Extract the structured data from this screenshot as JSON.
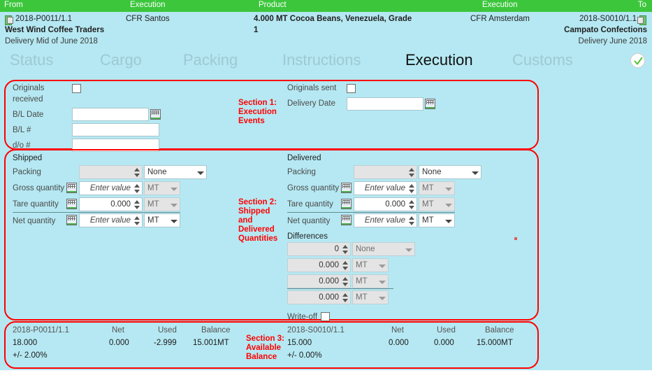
{
  "topbar": {
    "from": "From",
    "execution_left": "Execution",
    "product": "Product",
    "execution_right": "Execution",
    "to": "To"
  },
  "header": {
    "left_ref": "2018-P0011/1.1",
    "left_party": "West Wind Coffee Traders",
    "left_delivery": "Delivery Mid of June 2018",
    "left_incoterm": "CFR Santos",
    "product_line1": "4.000 MT Cocoa Beans, Venezuela, Grade",
    "product_line2": "1",
    "right_incoterm": "CFR Amsterdam",
    "right_ref": "2018-S0010/1.1",
    "right_party": "Campato Confections",
    "right_delivery": "Delivery June 2018"
  },
  "tabs": {
    "items": [
      {
        "label": "Status",
        "active": false
      },
      {
        "label": "Cargo",
        "active": false
      },
      {
        "label": "Packing",
        "active": false
      },
      {
        "label": "Instructions",
        "active": false
      },
      {
        "label": "Execution",
        "active": true
      },
      {
        "label": "Customs",
        "active": false
      }
    ],
    "status_icon": "check-circle-icon"
  },
  "section1": {
    "label": "Section 1:\nExecution\nEvents",
    "label_lines": [
      "Section 1:",
      "Execution",
      "Events"
    ],
    "originals_received_label_line1": "Originals",
    "originals_received_label_line2": "received",
    "originals_received_checked": false,
    "bl_date_label": "B/L Date",
    "bl_date_value": "",
    "bl_number_label": "B/L #",
    "bl_number_value": "",
    "do_number_label": "d/o #",
    "do_number_value": "",
    "originals_sent_label": "Originals sent",
    "originals_sent_checked": false,
    "delivery_date_label": "Delivery Date",
    "delivery_date_value": ""
  },
  "section2": {
    "label_lines": [
      "Section 2:",
      "Shipped",
      "and",
      "Delivered",
      "Quantities"
    ],
    "shipped": {
      "title": "Shipped",
      "packing_label": "Packing",
      "packing_count": "",
      "packing_type": "None",
      "gross_label": "Gross quantity",
      "gross_value": "Enter value",
      "gross_unit": "MT",
      "tare_label": "Tare quantity",
      "tare_value": "0.000",
      "tare_unit": "MT",
      "net_label": "Net quantity",
      "net_value": "Enter value",
      "net_unit": "MT"
    },
    "delivered": {
      "title": "Delivered",
      "packing_label": "Packing",
      "packing_count": "",
      "packing_type": "None",
      "gross_label": "Gross quantity",
      "gross_value": "Enter value",
      "gross_unit": "MT",
      "tare_label": "Tare quantity",
      "tare_value": "0.000",
      "tare_unit": "MT",
      "net_label": "Net quantity",
      "net_value": "Enter value",
      "net_unit": "MT"
    },
    "differences": {
      "title": "Differences",
      "packing_count": "0",
      "packing_type": "None",
      "gross_value": "0.000",
      "gross_unit": "MT",
      "tare_value": "0.000",
      "tare_unit": "MT",
      "net_value": "0.000",
      "net_unit": "MT",
      "writeoff_label": "Write-off",
      "writeoff_checked": false
    }
  },
  "section3": {
    "label_lines": [
      "Section 3:",
      "Available",
      "Balance"
    ],
    "left": {
      "ref": "2018-P0011/1.1",
      "net_header": "Net",
      "used_header": "Used",
      "balance_header": "Balance",
      "quantity": "18.000",
      "net": "0.000",
      "used": "-2.999",
      "balance": "15.001MT",
      "tolerance": "+/- 2.00%"
    },
    "right": {
      "ref": "2018-S0010/1.1",
      "net_header": "Net",
      "used_header": "Used",
      "balance_header": "Balance",
      "quantity": "15.000",
      "net": "0.000",
      "used": "0.000",
      "balance": "15.000MT",
      "tolerance": "+/- 0.00%"
    }
  },
  "colors": {
    "topbar_green": "#3cc63c",
    "body_cyan": "#b5e8f2",
    "annotation_red": "#ff0000",
    "field_white": "#ffffff",
    "field_disabled": "#e4e4e4"
  }
}
